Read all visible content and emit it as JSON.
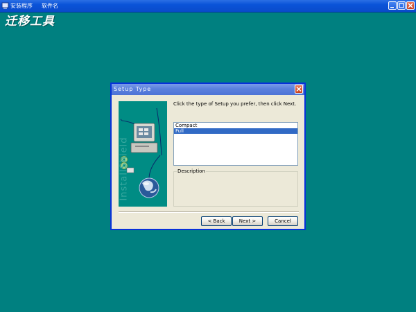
{
  "host_window": {
    "title": "安装程序",
    "menu_label": "软件名",
    "brand": "迁移工具"
  },
  "dialog": {
    "title": "Setup Type",
    "instruction": "Click the type of Setup you prefer, then click Next.",
    "options": [
      {
        "label": "Compact",
        "selected": false
      },
      {
        "label": "Full",
        "selected": true
      }
    ],
    "description_label": "Description",
    "buttons": {
      "back": "< Back",
      "next": "Next >",
      "cancel": "Cancel"
    }
  },
  "side_image": {
    "watermark": "InstallShield"
  },
  "colors": {
    "desktop": "#008080",
    "dialog_face": "#ece9d8",
    "selection": "#316ac5"
  }
}
